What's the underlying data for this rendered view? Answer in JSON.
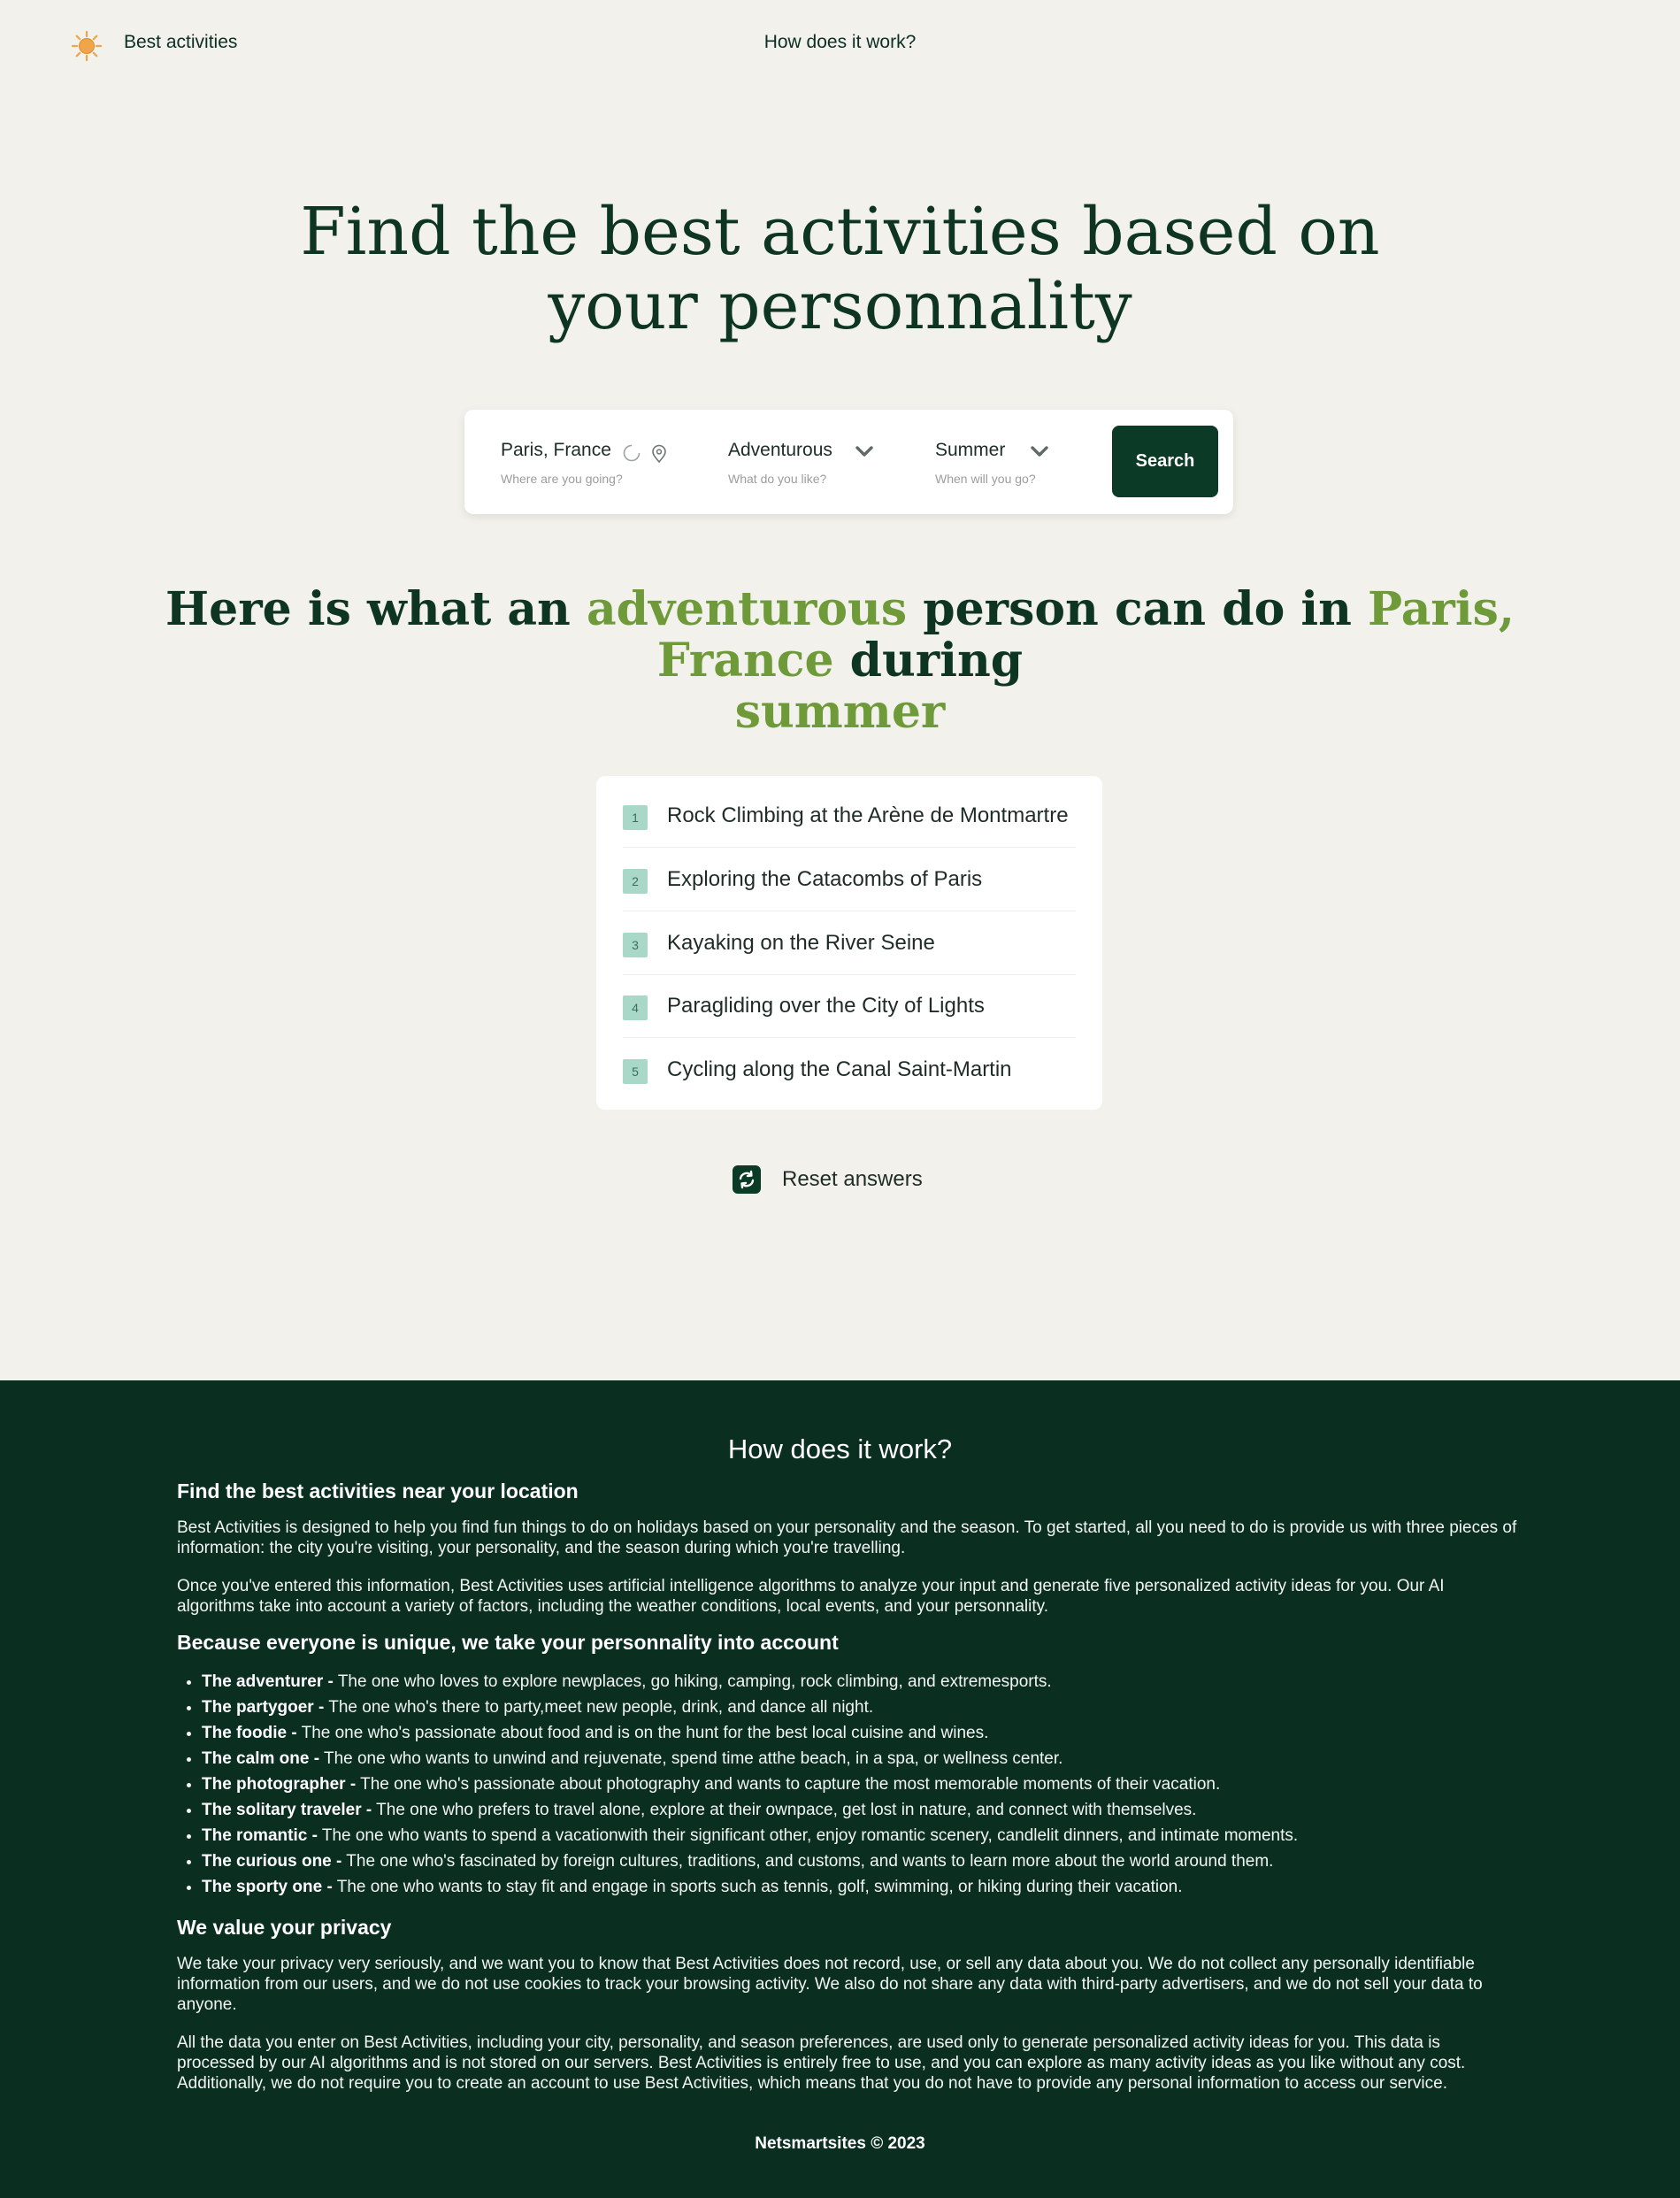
{
  "nav": {
    "brand": "Best activities",
    "link": "How does it work?"
  },
  "hero": {
    "title": "Find the best activities based on your personnality"
  },
  "search": {
    "location_value": "Paris, France",
    "location_hint": "Where are you going?",
    "personality_value": "Adventurous",
    "personality_hint": "What do you like?",
    "season_value": "Summer",
    "season_hint": "When will you go?",
    "button": "Search"
  },
  "result": {
    "prefix": "Here is what an",
    "personality": "adventurous",
    "middle": "person can do in",
    "location": "Paris, France",
    "connector": "during",
    "season": "summer"
  },
  "activities": [
    {
      "num": "1",
      "label": "Rock Climbing at the Arène de Montmartre"
    },
    {
      "num": "2",
      "label": "Exploring the Catacombs of Paris"
    },
    {
      "num": "3",
      "label": "Kayaking on the River Seine"
    },
    {
      "num": "4",
      "label": "Paragliding over the City of Lights"
    },
    {
      "num": "5",
      "label": "Cycling along the Canal Saint-Martin"
    }
  ],
  "reset": {
    "label": "Reset answers"
  },
  "footer": {
    "title": "How does it work?",
    "h_location": "Find the best activities near your location",
    "p1": "Best Activities is designed to help you find fun things to do on holidays based on your personality and the season. To get started, all you need to do is provide us with three pieces of information: the city you're visiting, your personality, and the season during which you're travelling.",
    "p2": "Once you've entered this information, Best Activities uses artificial intelligence algorithms to analyze your input and generate five personalized activity ideas for you. Our AI algorithms take into account a variety of factors, including the weather conditions, local events, and your personnality.",
    "h_unique": "Because everyone is unique, we take your personnality into account",
    "types": [
      {
        "name": "The adventurer -",
        "desc": "The one who loves to explore newplaces, go hiking, camping, rock climbing, and extremesports."
      },
      {
        "name": "The partygoer -",
        "desc": "The one who's there to party,meet new people, drink, and dance all night."
      },
      {
        "name": "The foodie -",
        "desc": "The one who's passionate about food and is on the hunt for the best local cuisine and wines."
      },
      {
        "name": "The calm one -",
        "desc": "The one who wants to unwind and rejuvenate, spend time atthe beach, in a spa, or wellness center."
      },
      {
        "name": "The photographer -",
        "desc": "The one who's passionate about photography and wants to capture the most memorable moments of their vacation."
      },
      {
        "name": "The solitary traveler -",
        "desc": "The one who prefers to travel alone, explore at their ownpace, get lost in nature, and connect with themselves."
      },
      {
        "name": "The romantic -",
        "desc": "The one who wants to spend a vacationwith their significant other, enjoy romantic scenery, candlelit dinners, and intimate moments."
      },
      {
        "name": "The curious one -",
        "desc": "The one who's fascinated by foreign cultures, traditions, and customs, and wants to learn more about the world around them."
      },
      {
        "name": "The sporty one -",
        "desc": "The one who wants to stay fit and engage in sports such as tennis, golf, swimming, or hiking during their vacation."
      }
    ],
    "h_privacy": "We value your privacy",
    "p3": "We take your privacy very seriously, and we want you to know that Best Activities does not record, use, or sell any data about you. We do not collect any personally identifiable information from our users, and we do not use cookies to track your browsing activity. We also do not share any data with third-party advertisers, and we do not sell your data to anyone.",
    "p4": "All the data you enter on Best Activities, including your city, personality, and season preferences, are used only to generate personalized activity ideas for you. This data is processed by our AI algorithms and is not stored on our servers. Best Activities is entirely free to use, and you can explore as many activity ideas as you like without any cost. Additionally, we do not require you to create an account to use Best Activities, which means that you do not have to provide any personal information to access our service.",
    "copyright": "Netsmartsites © 2023"
  },
  "colors": {
    "background": "#f3f1eb",
    "dark_green": "#0b3a26",
    "footer_bg": "#0a2e20",
    "accent_green": "#6e9a3a",
    "badge": "#a9d8c8",
    "sun": "#f0a54a"
  },
  "icons": {
    "logo": "sun-icon",
    "location_loading": "spinner-icon",
    "location_pin": "map-pin-icon",
    "dropdown": "chevron-down-icon",
    "reset": "refresh-icon"
  }
}
